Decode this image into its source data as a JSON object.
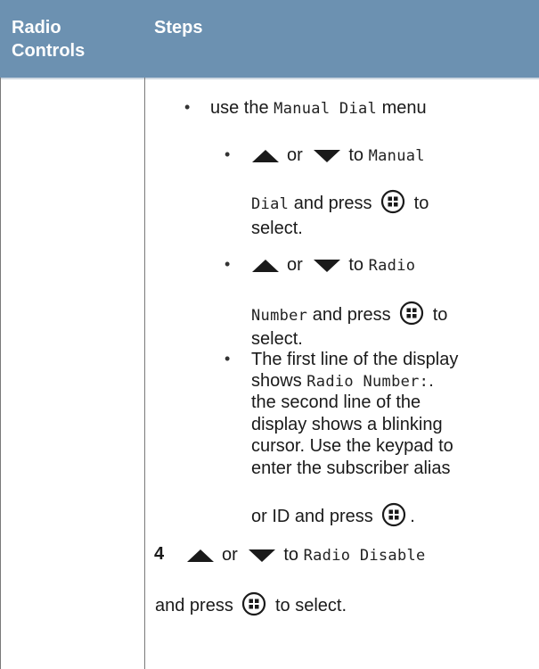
{
  "table": {
    "header": {
      "col1": "Radio Controls",
      "col2": "Steps"
    }
  },
  "steps": {
    "bullet_char": "•",
    "b1": {
      "text": "use the",
      "mono": "Manual Dial",
      "text2": "menu"
    },
    "b1a": {
      "or": "or",
      "to": "to",
      "mono1": "Manual",
      "mono2": "Dial",
      "text2": "and press",
      "text3": "to",
      "text4": "select."
    },
    "b1b": {
      "or": "or",
      "to": "to",
      "mono1": "Radio",
      "mono2": "Number",
      "text2": "and press",
      "text3": "to",
      "text4": "select."
    },
    "b1c": {
      "line1": "The first line of the display",
      "shows": "shows",
      "mono": "Radio Number:",
      "dot": ".",
      "line3": "the second line of the",
      "line4": "display shows a blinking",
      "line5": "cursor. Use the keypad to",
      "line6": "enter the subscriber alias",
      "line7": "or ID and press",
      "end": "."
    },
    "step4": {
      "number": "4",
      "or": "or",
      "to": "to",
      "mono": "Radio Disable",
      "line2a": "and press",
      "line2b": "to select."
    }
  },
  "icons": [
    "up-arrow-icon",
    "down-arrow-icon",
    "menu-ok-button-icon"
  ],
  "colors": {
    "header_bg": "#6c91b1",
    "header_text": "#ffffff",
    "rule": "#7a7a7a"
  }
}
